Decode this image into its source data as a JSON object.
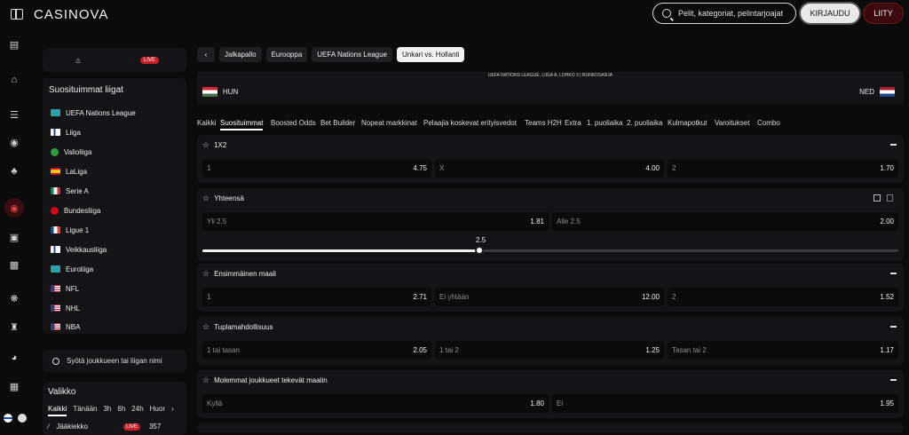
{
  "header": {
    "logo": "CASINOVA",
    "search_placeholder": "Pelit, kategoriat, pelintarjoajat",
    "login_label": "KIRJAUDU",
    "join_label": "LIITY"
  },
  "rail_icons": [
    "gift-icon",
    "home-icon",
    "betslip-icon",
    "jersey-icon",
    "clover-icon",
    "live-icon",
    "tv-icon",
    "ticket-icon",
    "badge-icon",
    "trophy-icon",
    "speed-icon",
    "casino-icon"
  ],
  "left": {
    "live_badge": "LIVE",
    "leagues_title": "Suosituimmat liigat",
    "leagues": [
      {
        "name": "UEFA Nations League",
        "flag": "uefa"
      },
      {
        "name": "Liiga",
        "flag": "fi"
      },
      {
        "name": "Valioliiga",
        "flag": "pl"
      },
      {
        "name": "LaLiga",
        "flag": "es"
      },
      {
        "name": "Serie A",
        "flag": "it"
      },
      {
        "name": "Bundesliiga",
        "flag": "bl"
      },
      {
        "name": "Ligue 1",
        "flag": "fr"
      },
      {
        "name": "Veikkausliiga",
        "flag": "fi"
      },
      {
        "name": "Euroliiga",
        "flag": "uefa"
      },
      {
        "name": "NFL",
        "flag": "us"
      },
      {
        "name": "NHL",
        "flag": "us"
      },
      {
        "name": "NBA",
        "flag": "us"
      }
    ],
    "team_search_placeholder": "Syötä joukkueen tai liigan nimi",
    "menu_title": "Valikko",
    "menu_tabs": [
      "Kaikki",
      "Tänään",
      "3h",
      "6h",
      "24h",
      "Huor"
    ],
    "menu_row": {
      "label": "Jääkiekko",
      "live": "LIVE",
      "count": "357"
    }
  },
  "breadcrumbs": [
    "Jalkapallo",
    "Eurooppa",
    "UEFA Nations League",
    "Unkari vs. Hollanti"
  ],
  "match": {
    "competition": "UEFA NATIONS LEAGUE, LIIGA A, LOHKO 3 | RUNKOSARJA",
    "home": "HUN",
    "away": "NED"
  },
  "market_tabs": [
    "Kaikki",
    "Suosituimmat",
    "Boosted Odds",
    "Bet Builder",
    "Nopeat markkinat",
    "Pelaajia koskevat erityisvedot",
    "Teams H2H",
    "Extra",
    "1. puoliaika",
    "2. puoliaika",
    "Kulmapotkut",
    "Varoitukset",
    "Combo"
  ],
  "markets": [
    {
      "title": "1X2",
      "odds": [
        {
          "label": "1",
          "value": "4.75"
        },
        {
          "label": "X",
          "value": "4.00"
        },
        {
          "label": "2",
          "value": "1.70"
        }
      ]
    },
    {
      "title": "Yhteensä",
      "odds": [
        {
          "label": "Yli 2.5",
          "value": "1.81"
        },
        {
          "label": "Alle 2.5",
          "value": "2.00"
        }
      ],
      "slider": {
        "value": "2.5"
      }
    },
    {
      "title": "Ensimmäinen maali",
      "odds": [
        {
          "label": "1",
          "value": "2.71"
        },
        {
          "label": "Ei yhtään",
          "value": "12.00"
        },
        {
          "label": "2",
          "value": "1.52"
        }
      ]
    },
    {
      "title": "Tuplamahdollisuus",
      "odds": [
        {
          "label": "1 tai tasan",
          "value": "2.05"
        },
        {
          "label": "1 tai 2",
          "value": "1.25"
        },
        {
          "label": "Tasan tai 2",
          "value": "1.17"
        }
      ]
    },
    {
      "title": "Molemmat joukkueet tekevät maalin",
      "odds": [
        {
          "label": "Kyllä",
          "value": "1.80"
        },
        {
          "label": "Ei",
          "value": "1.95"
        }
      ]
    }
  ]
}
